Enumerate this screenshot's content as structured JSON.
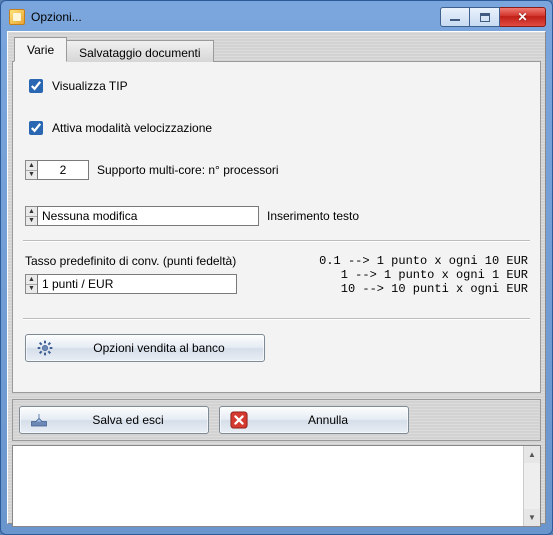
{
  "window": {
    "title": "Opzioni..."
  },
  "tabs": {
    "varie": "Varie",
    "salvataggio": "Salvataggio documenti"
  },
  "checks": {
    "visualizza_tip": "Visualizza TIP",
    "attiva_vel": "Attiva modalità velocizzazione"
  },
  "multicore": {
    "value": "2",
    "label": "Supporto multi-core: n° processori"
  },
  "inserimento": {
    "value": "Nessuna modifica",
    "label": "Inserimento testo"
  },
  "conv": {
    "label": "Tasso predefinito di conv. (punti fedeltà)",
    "value": "1 punti / EUR",
    "hint": "0.1 --> 1 punto x ogni 10 EUR\n  1 --> 1 punto x ogni 1 EUR\n 10 --> 10 punti x ogni EUR"
  },
  "buttons": {
    "opzioni_vendita": "Opzioni vendita al banco",
    "salva": "Salva ed esci",
    "annulla": "Annulla"
  }
}
